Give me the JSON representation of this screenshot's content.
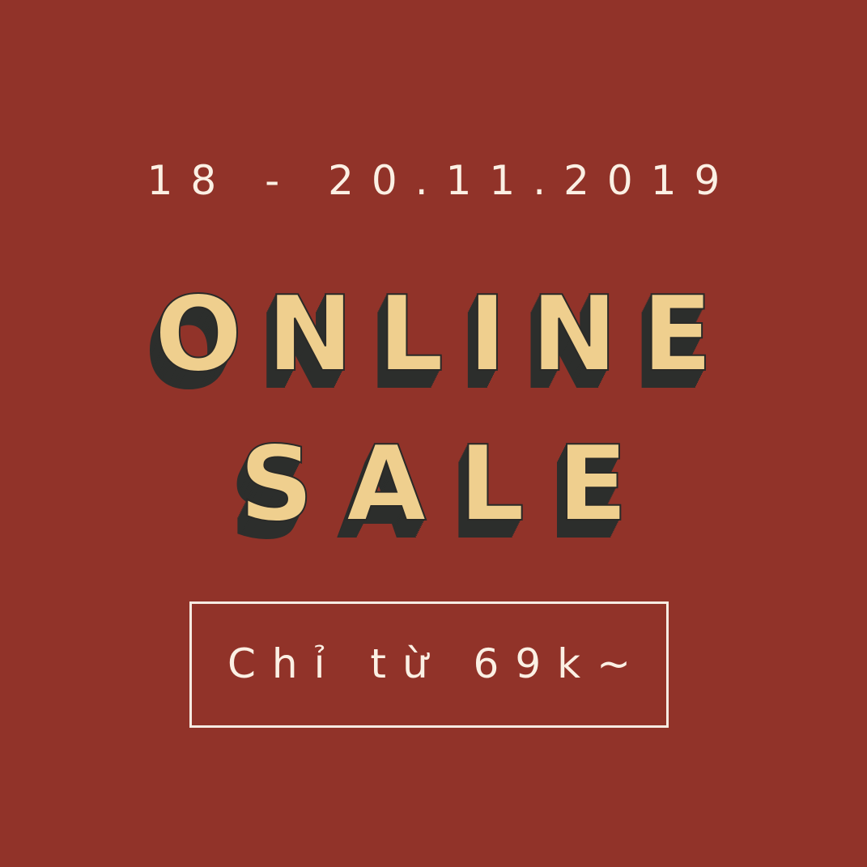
{
  "colors": {
    "background": "#913329",
    "headline_fill": "#efcf8e",
    "headline_shadow": "#2c2e2c",
    "text_light": "#fbf0e4"
  },
  "poster": {
    "date": "18 - 20.11.2019",
    "headline_line1": "ONLINE",
    "headline_line2": "SALE",
    "price": "Chỉ từ 69k~"
  }
}
